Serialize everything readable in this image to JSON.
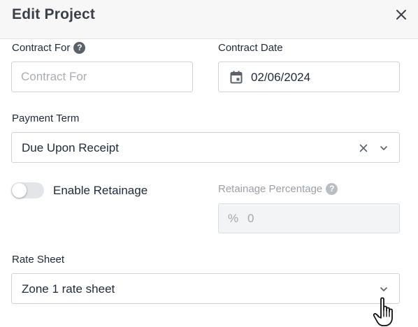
{
  "header": {
    "title": "Edit Project"
  },
  "contract_for": {
    "label": "Contract For",
    "placeholder": "Contract For",
    "value": ""
  },
  "contract_date": {
    "label": "Contract Date",
    "value": "02/06/2024"
  },
  "payment_term": {
    "label": "Payment Term",
    "value": "Due Upon Receipt"
  },
  "retainage": {
    "toggle_label": "Enable Retainage",
    "enabled": false,
    "percentage_label": "Retainage Percentage",
    "percent_symbol": "%",
    "value": "0"
  },
  "rate_sheet": {
    "label": "Rate Sheet",
    "value": "Zone 1 rate sheet"
  },
  "icons": {
    "help": "?",
    "close": "close-icon",
    "calendar": "calendar-icon",
    "chevron": "chevron-down-icon",
    "clear": "clear-icon",
    "cursor": "hand-pointer-icon"
  },
  "colors": {
    "header_bg": "#f7f7f7",
    "border": "#cfd3d8",
    "disabled_bg": "#f3f4f6",
    "toggle_off": "#e3e5e8"
  }
}
